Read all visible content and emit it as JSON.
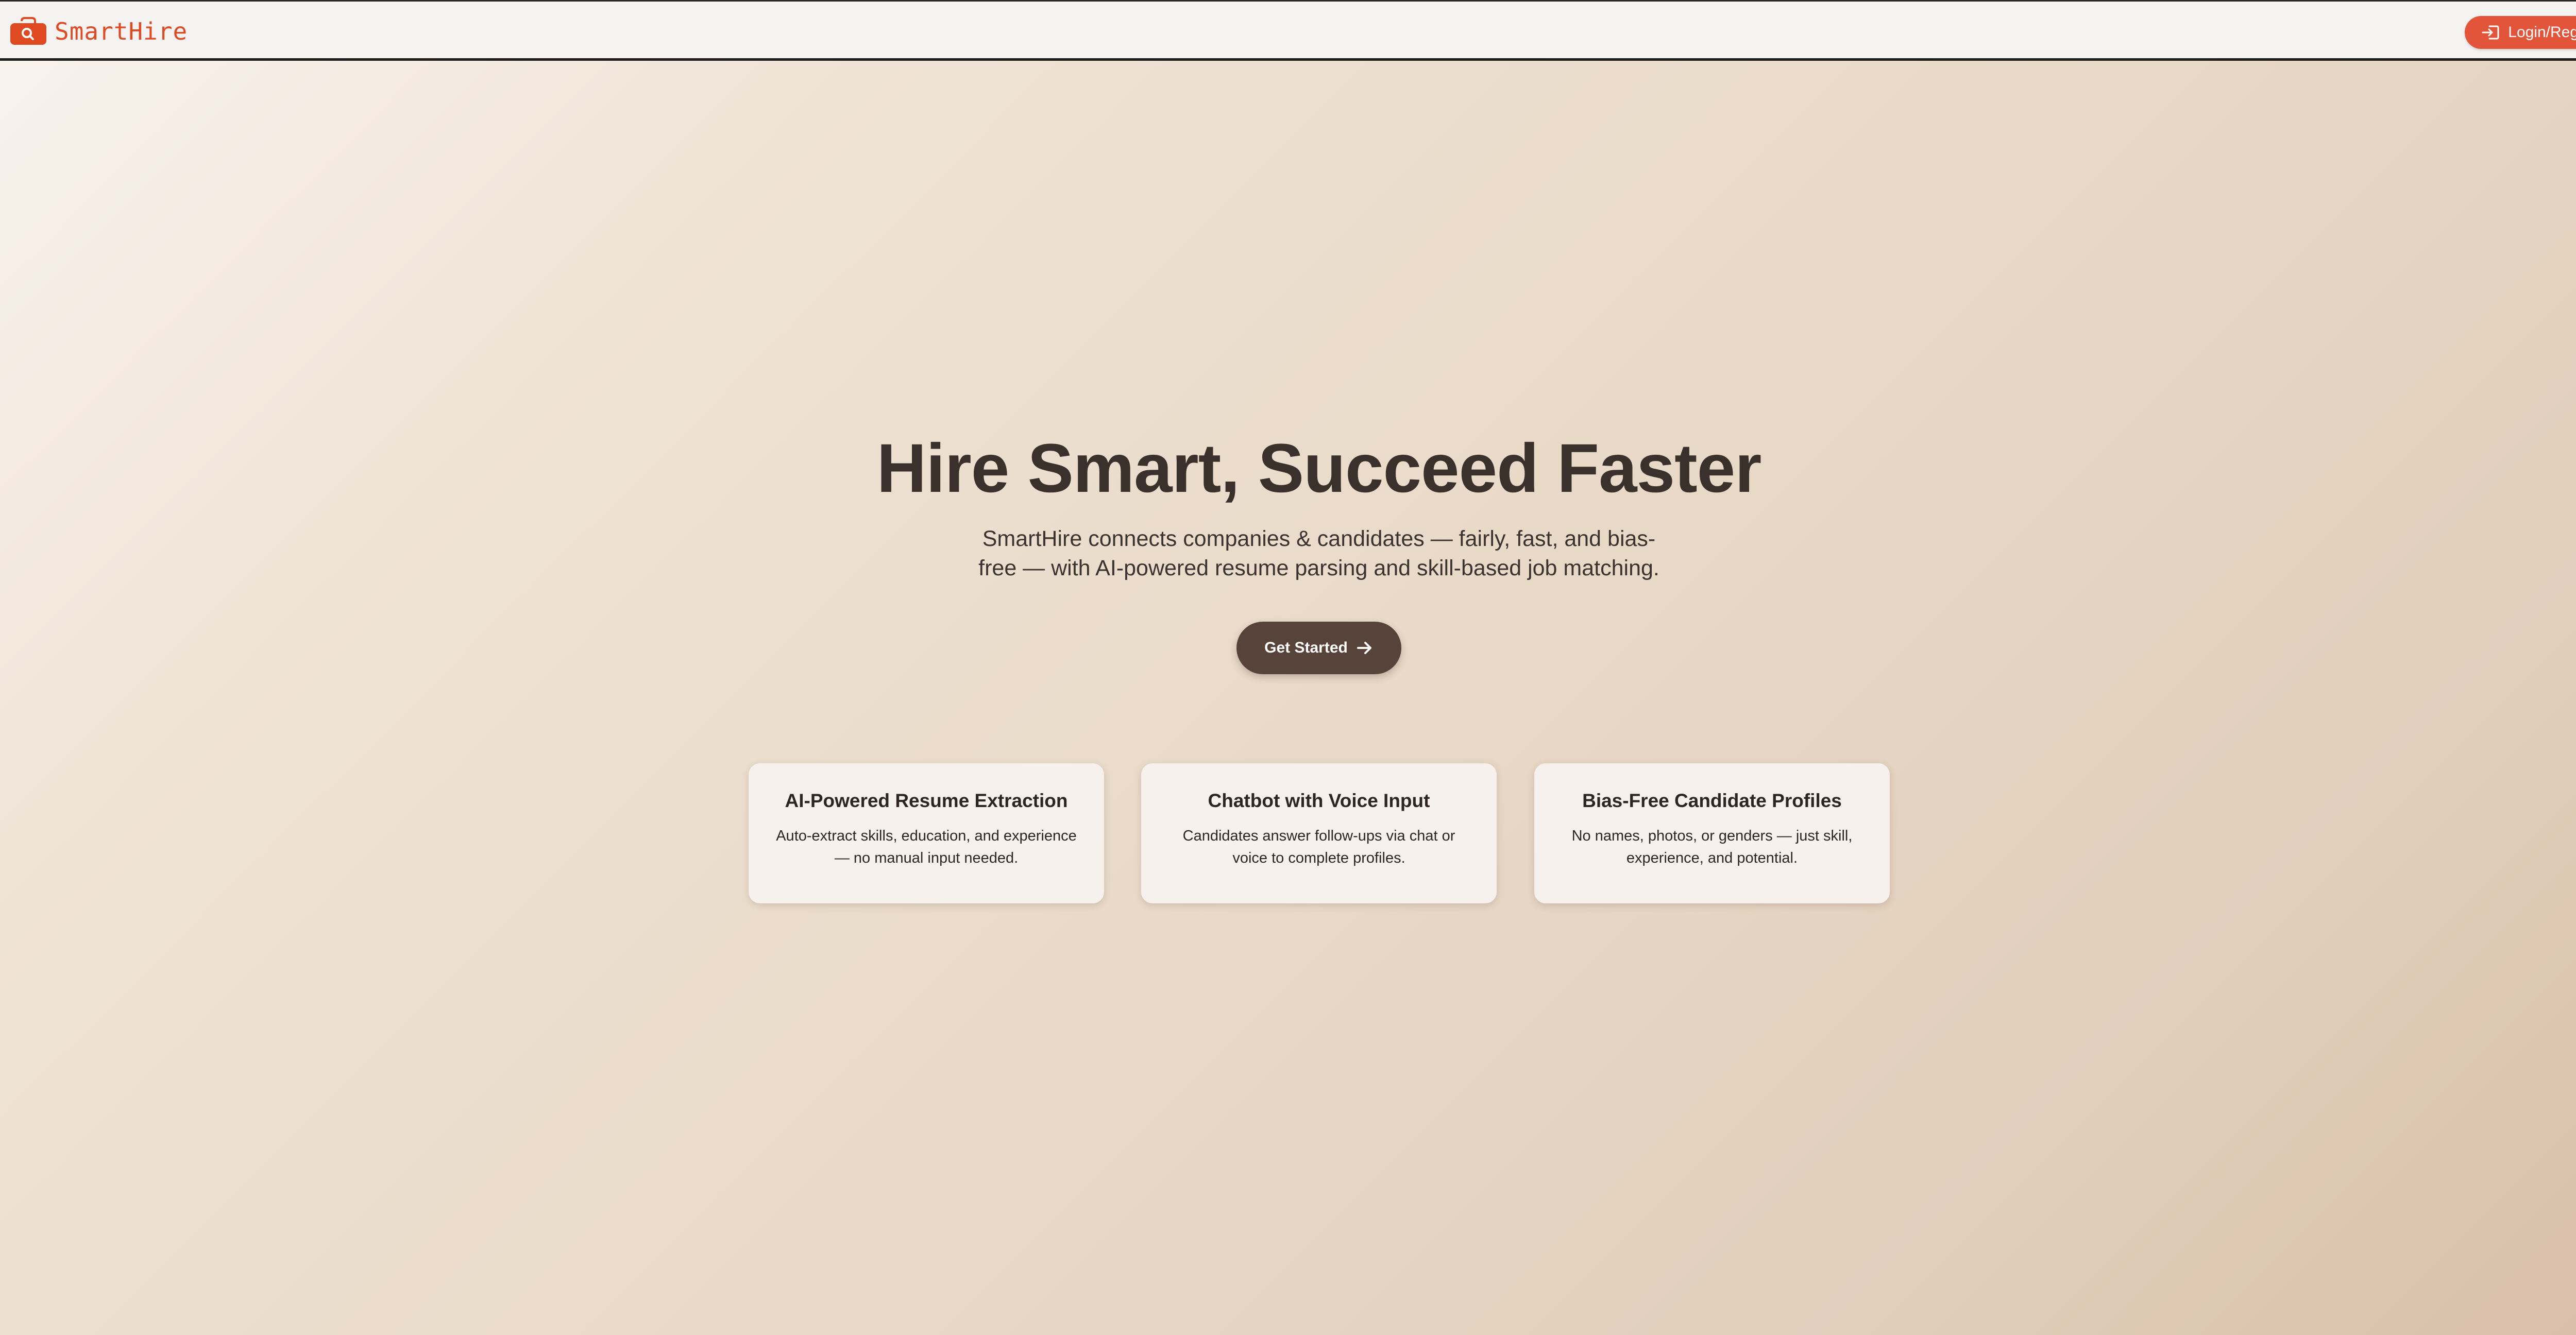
{
  "header": {
    "brand_name": "SmartHire",
    "login_label": "Login/Register",
    "brand_color": "#e04a22",
    "login_color": "#e2553a"
  },
  "hero": {
    "title": "Hire Smart, Succeed Faster",
    "subtitle": "SmartHire connects companies & candidates — fairly, fast, and bias-free — with AI-powered resume parsing and skill-based job matching.",
    "cta_label": "Get Started",
    "cta_color": "#574339"
  },
  "features": [
    {
      "title": "AI-Powered Resume Extraction",
      "description": "Auto-extract skills, education, and experience — no manual input needed."
    },
    {
      "title": "Chatbot with Voice Input",
      "description": "Candidates answer follow-ups via chat or voice to complete profiles."
    },
    {
      "title": "Bias-Free Candidate Profiles",
      "description": "No names, photos, or genders — just skill, experience, and potential."
    }
  ],
  "icons": {
    "logo": "briefcase-search-icon",
    "login": "login-icon",
    "cta": "arrow-right-icon",
    "scroll": "chevron-down-icon"
  }
}
